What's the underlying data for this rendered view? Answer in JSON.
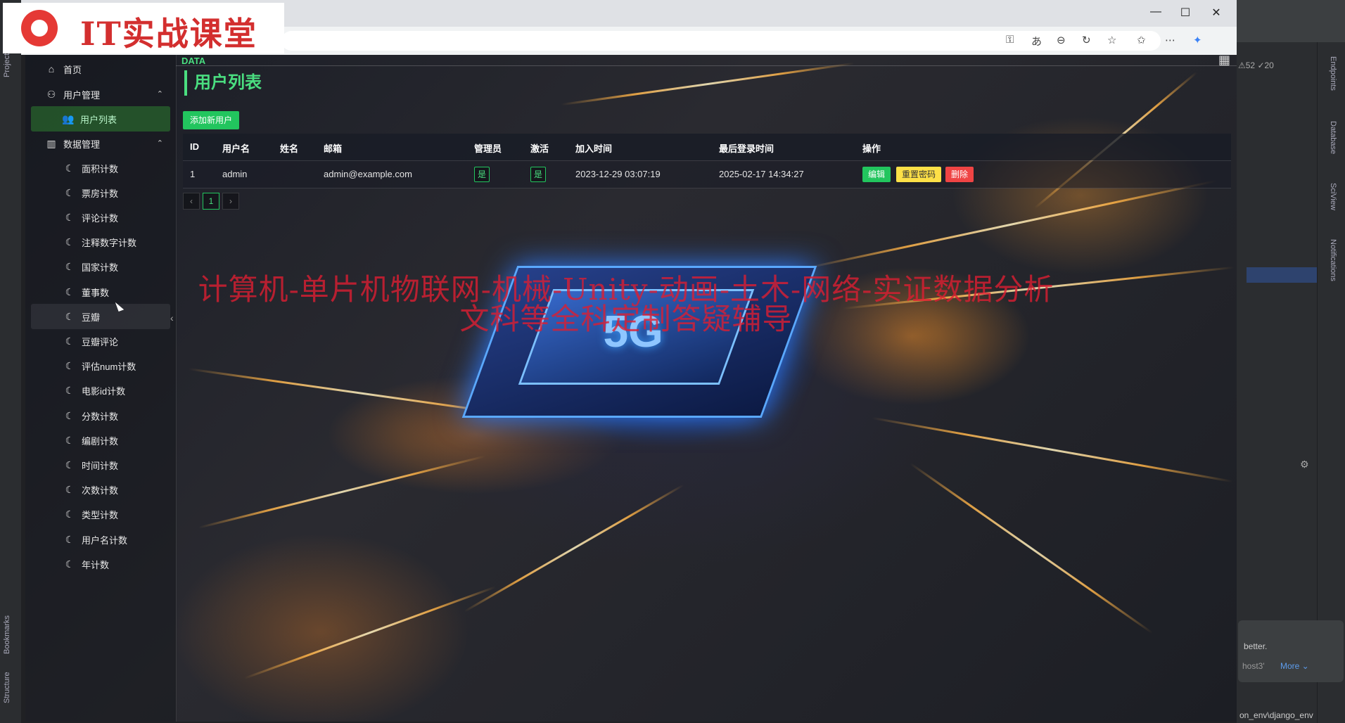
{
  "logo": {
    "text": "IT实战课堂"
  },
  "window": {
    "minimize": "—",
    "maximize": "☐",
    "close": "✕"
  },
  "header": {
    "brand": "DATA",
    "page_title": "用户列表"
  },
  "sidebar": {
    "home": "首页",
    "user_mgmt": "用户管理",
    "user_list": "用户列表",
    "data_mgmt": "数据管理",
    "items": [
      "面积计数",
      "票房计数",
      "评论计数",
      "注释数字计数",
      "国家计数",
      "董事数",
      "豆瓣",
      "豆瓣评论",
      "评估num计数",
      "电影id计数",
      "分数计数",
      "编剧计数",
      "时间计数",
      "次数计数",
      "类型计数",
      "用户名计数",
      "年计数"
    ]
  },
  "actions": {
    "add_user": "添加新用户"
  },
  "table": {
    "headers": [
      "ID",
      "用户名",
      "姓名",
      "邮箱",
      "管理员",
      "激活",
      "加入时间",
      "最后登录时间",
      "操作"
    ],
    "rows": [
      {
        "id": "1",
        "username": "admin",
        "name": "",
        "email": "admin@example.com",
        "is_admin": "是",
        "is_active": "是",
        "joined": "2023-12-29 03:07:19",
        "last_login": "2025-02-17 14:34:27"
      }
    ],
    "row_actions": {
      "edit": "编辑",
      "reset": "重置密码",
      "delete": "删除"
    }
  },
  "pagination": {
    "prev": "‹",
    "current": "1",
    "next": "›"
  },
  "watermark": {
    "line1": "计算机-单片机物联网-机械-Unity-动画-土木-网络-实证数据分析",
    "line2": "文科等全科定制答疑辅导"
  },
  "ide": {
    "stats": "⚠52 ✓20",
    "notif_text": "better.",
    "notif_more": "More ⌄",
    "notif_prefix": "host3'",
    "path": "on_env\\django_env",
    "side_labels": [
      "Endpoints",
      "Database",
      "SciView",
      "Notifications"
    ],
    "left_labels": [
      "Project",
      "Bookmarks",
      "Structure"
    ]
  },
  "colors": {
    "accent": "#22c55e",
    "accent_text": "#4ade80",
    "warn": "#fde047",
    "danger": "#ef4444"
  }
}
